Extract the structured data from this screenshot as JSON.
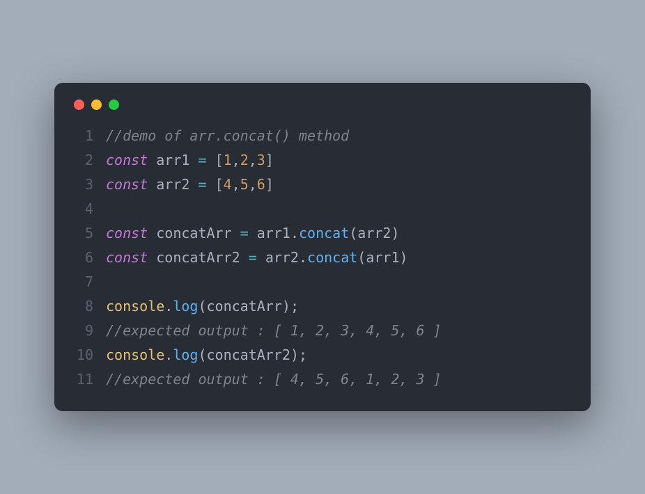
{
  "titlebar": {
    "close": "red",
    "minimize": "yellow",
    "zoom": "green"
  },
  "code": {
    "line_numbers": [
      "1",
      "2",
      "3",
      "4",
      "5",
      "6",
      "7",
      "8",
      "9",
      "10",
      "11"
    ],
    "t": {
      "c1": "//demo of arr.concat() method",
      "kw_const": "const",
      "arr1": "arr1",
      "arr2": "arr2",
      "concatArr": "concatArr",
      "concatArr2": "concatArr2",
      "eq": " = ",
      "lb": "[",
      "rb": "]",
      "comma": ",",
      "n1": "1",
      "n2": "2",
      "n3": "3",
      "n4": "4",
      "n5": "5",
      "n6": "6",
      "dot": ".",
      "concat": "concat",
      "lp": "(",
      "rp": ")",
      "semi": ";",
      "console": "console",
      "log": "log",
      "c9": "//expected output : [ 1, 2, 3, 4, 5, 6 ]",
      "c11": "//expected output : [ 4, 5, 6, 1, 2, 3 ]",
      "sp": " "
    }
  }
}
